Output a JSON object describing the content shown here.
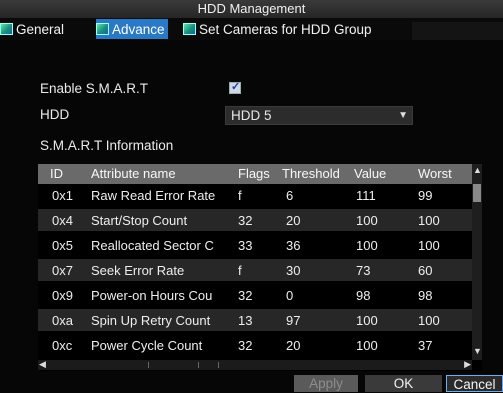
{
  "window": {
    "title": "HDD Management"
  },
  "tabs": [
    {
      "label": "General",
      "icon": "tab-icon"
    },
    {
      "label": "Advance",
      "icon": "tab-icon",
      "active": true
    },
    {
      "label": "Set Cameras for HDD Group",
      "icon": "tab-icon"
    }
  ],
  "form": {
    "smart_label": "Enable S.M.A.R.T",
    "smart_checked": true,
    "checkmark": "✓",
    "hdd_label": "HDD",
    "hdd_value": "HDD 5",
    "smart_info_label": "S.M.A.R.T Information"
  },
  "table": {
    "columns": [
      "ID",
      "Attribute name",
      "Flags",
      "Threshold",
      "Value",
      "Worst"
    ],
    "rows": [
      [
        "0x1",
        "Raw Read Error Rate",
        "f",
        "6",
        "111",
        "99"
      ],
      [
        "0x4",
        "Start/Stop Count",
        "32",
        "20",
        "100",
        "100"
      ],
      [
        "0x5",
        "Reallocated Sector C",
        "33",
        "36",
        "100",
        "100"
      ],
      [
        "0x7",
        "Seek Error Rate",
        "f",
        "30",
        "73",
        "60"
      ],
      [
        "0x9",
        "Power-on Hours Cou",
        "32",
        "0",
        "98",
        "98"
      ],
      [
        "0xa",
        "Spin Up Retry Count",
        "13",
        "97",
        "100",
        "100"
      ],
      [
        "0xc",
        "Power Cycle Count",
        "32",
        "20",
        "100",
        "37"
      ]
    ]
  },
  "buttons": {
    "apply": "Apply",
    "ok": "OK",
    "cancel": "Cancel"
  },
  "colors": {
    "active_tab": "#2a79c6",
    "header_bg": "#6a6a6a",
    "focus_border": "#6aaef5"
  }
}
